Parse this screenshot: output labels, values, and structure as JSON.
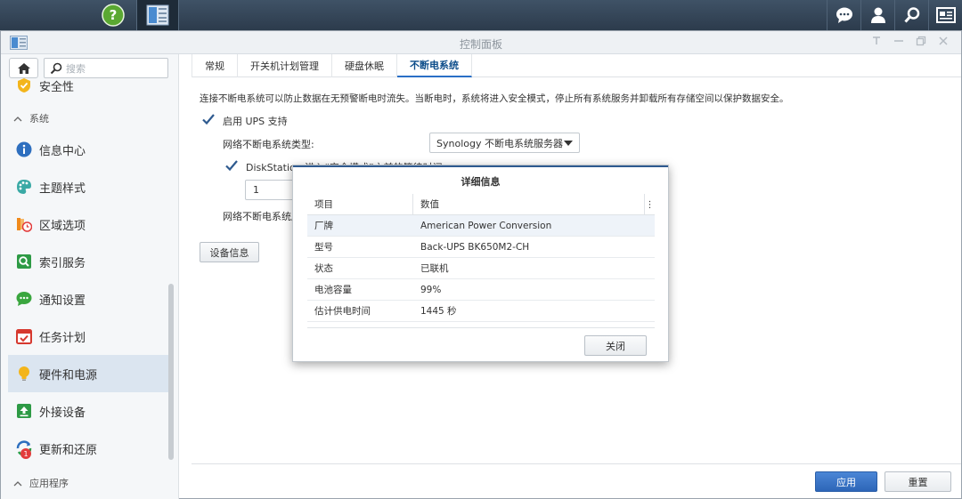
{
  "window": {
    "title": "控制面板"
  },
  "sidebar": {
    "search_placeholder": "搜索",
    "items_top": [
      {
        "label": "安全性",
        "icon": "shield-icon"
      }
    ],
    "group_system": "系统",
    "items": [
      {
        "label": "信息中心",
        "icon": "info-icon"
      },
      {
        "label": "主题样式",
        "icon": "palette-icon"
      },
      {
        "label": "区域选项",
        "icon": "region-icon"
      },
      {
        "label": "索引服务",
        "icon": "index-icon"
      },
      {
        "label": "通知设置",
        "icon": "chat-icon"
      },
      {
        "label": "任务计划",
        "icon": "calendar-icon"
      },
      {
        "label": "硬件和电源",
        "icon": "bulb-icon"
      },
      {
        "label": "外接设备",
        "icon": "upload-icon"
      },
      {
        "label": "更新和还原",
        "icon": "update-icon"
      }
    ],
    "update_badge": "1",
    "group_apps": "应用程序"
  },
  "tabs": [
    "常规",
    "开关机计划管理",
    "硬盘休眠",
    "不断电系统"
  ],
  "main": {
    "description": "连接不断电系统可以防止数据在无预警断电时流失。当断电时，系统将进入安全模式，停止所有系统服务并卸载所有存储空间以保护数据安全。",
    "enable_ups_label": "启用 UPS 支持",
    "ups_type_label": "网络不断电系统类型:",
    "ups_type_value": "Synology 不断电系统服务器",
    "wait_label": "DiskStation 进入“安全模式”之前的等待时间",
    "wait_value": "1",
    "server_label": "网络不断电系统服",
    "device_info_button": "设备信息",
    "apply_button": "应用",
    "reset_button": "重置"
  },
  "modal": {
    "title": "详细信息",
    "col_item": "项目",
    "col_value": "数值",
    "rows": [
      {
        "item": "厂牌",
        "value": "American Power Conversion"
      },
      {
        "item": "型号",
        "value": "Back-UPS BK650M2-CH"
      },
      {
        "item": "状态",
        "value": "已联机"
      },
      {
        "item": "电池容量",
        "value": "99%"
      },
      {
        "item": "估计供电时间",
        "value": "1445 秒"
      }
    ],
    "close_button": "关闭"
  },
  "colors": {
    "accent": "#2a6fc6",
    "taskbar": "#34475a",
    "active_nav": "#dbe5f0"
  }
}
